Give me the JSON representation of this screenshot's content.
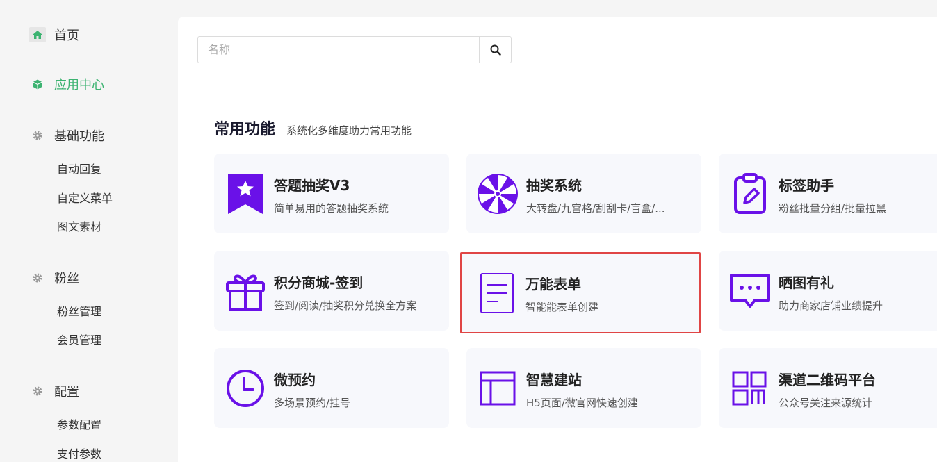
{
  "sidebar": {
    "home": "首页",
    "app_center": "应用中心",
    "groups": [
      {
        "label": "基础功能",
        "items": [
          "自动回复",
          "自定义菜单",
          "图文素材"
        ]
      },
      {
        "label": "粉丝",
        "items": [
          "粉丝管理",
          "会员管理"
        ]
      },
      {
        "label": "配置",
        "items": [
          "参数配置",
          "支付参数"
        ]
      }
    ]
  },
  "search": {
    "placeholder": "名称",
    "value": ""
  },
  "section": {
    "title": "常用功能",
    "subtitle": "系统化多维度助力常用功能"
  },
  "cards": [
    {
      "title": "答题抽奖V3",
      "desc": "简单易用的答题抽奖系统",
      "icon": "ribbon-star-icon"
    },
    {
      "title": "抽奖系统",
      "desc": "大转盘/九宫格/刮刮卡/盲盒/...",
      "icon": "wheel-icon"
    },
    {
      "title": "标签助手",
      "desc": "粉丝批量分组/批量拉黑",
      "icon": "clipboard-pen-icon"
    },
    {
      "title": "积分商城-签到",
      "desc": "签到/阅读/抽奖积分兑换全方案",
      "icon": "gift-icon"
    },
    {
      "title": "万能表单",
      "desc": "智能能表单创建",
      "icon": "form-document-icon"
    },
    {
      "title": "晒图有礼",
      "desc": "助力商家店铺业绩提升",
      "icon": "chat-bubble-icon"
    },
    {
      "title": "微预约",
      "desc": "多场景预约/挂号",
      "icon": "clock-icon"
    },
    {
      "title": "智慧建站",
      "desc": "H5页面/微官网快速创建",
      "icon": "layout-icon"
    },
    {
      "title": "渠道二维码平台",
      "desc": "公众号关注来源统计",
      "icon": "qrcode-icon"
    }
  ],
  "colors": {
    "accent": "#3cb371",
    "icon_purple": "#6a11e8",
    "highlight_border": "#e04545"
  }
}
